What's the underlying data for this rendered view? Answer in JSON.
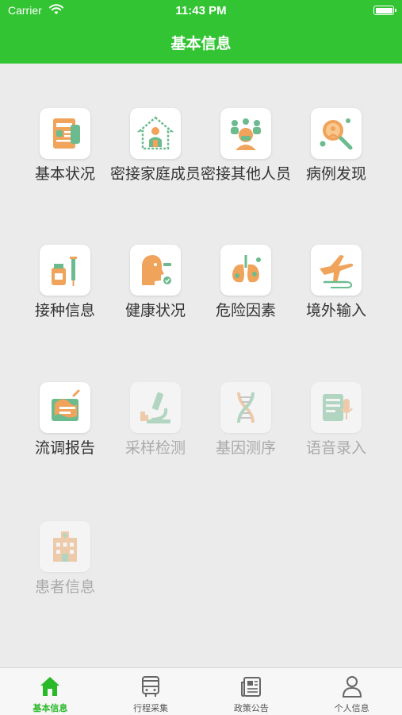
{
  "status": {
    "carrier": "Carrier",
    "time": "11:43 PM"
  },
  "nav": {
    "title": "基本信息"
  },
  "grid": [
    {
      "label": "基本状况",
      "icon": "id-card-icon",
      "enabled": true
    },
    {
      "label": "密接家庭成员",
      "icon": "house-family-icon",
      "enabled": true
    },
    {
      "label": "密接其他人员",
      "icon": "crowd-mask-icon",
      "enabled": true
    },
    {
      "label": "病例发现",
      "icon": "magnifier-virus-icon",
      "enabled": true
    },
    {
      "label": "接种信息",
      "icon": "vaccine-syringe-icon",
      "enabled": true
    },
    {
      "label": "健康状况",
      "icon": "thermometer-face-icon",
      "enabled": true
    },
    {
      "label": "危险因素",
      "icon": "lungs-virus-icon",
      "enabled": true
    },
    {
      "label": "境外输入",
      "icon": "airplane-icon",
      "enabled": true
    },
    {
      "label": "流调报告",
      "icon": "map-report-icon",
      "enabled": true
    },
    {
      "label": "采样检测",
      "icon": "microscope-icon",
      "enabled": false
    },
    {
      "label": "基因测序",
      "icon": "dna-icon",
      "enabled": false
    },
    {
      "label": "语音录入",
      "icon": "voice-document-icon",
      "enabled": false
    },
    {
      "label": "患者信息",
      "icon": "hospital-icon",
      "enabled": false
    }
  ],
  "tabs": [
    {
      "label": "基本信息",
      "icon": "home-icon",
      "active": true
    },
    {
      "label": "行程采集",
      "icon": "bus-icon",
      "active": false
    },
    {
      "label": "政策公告",
      "icon": "newspaper-icon",
      "active": false
    },
    {
      "label": "个人信息",
      "icon": "person-icon",
      "active": false
    }
  ],
  "colors": {
    "brand_green": "#33c433",
    "active_tab": "#29b929",
    "icon_orange": "#f0a35a",
    "icon_green": "#6cbb8f"
  }
}
